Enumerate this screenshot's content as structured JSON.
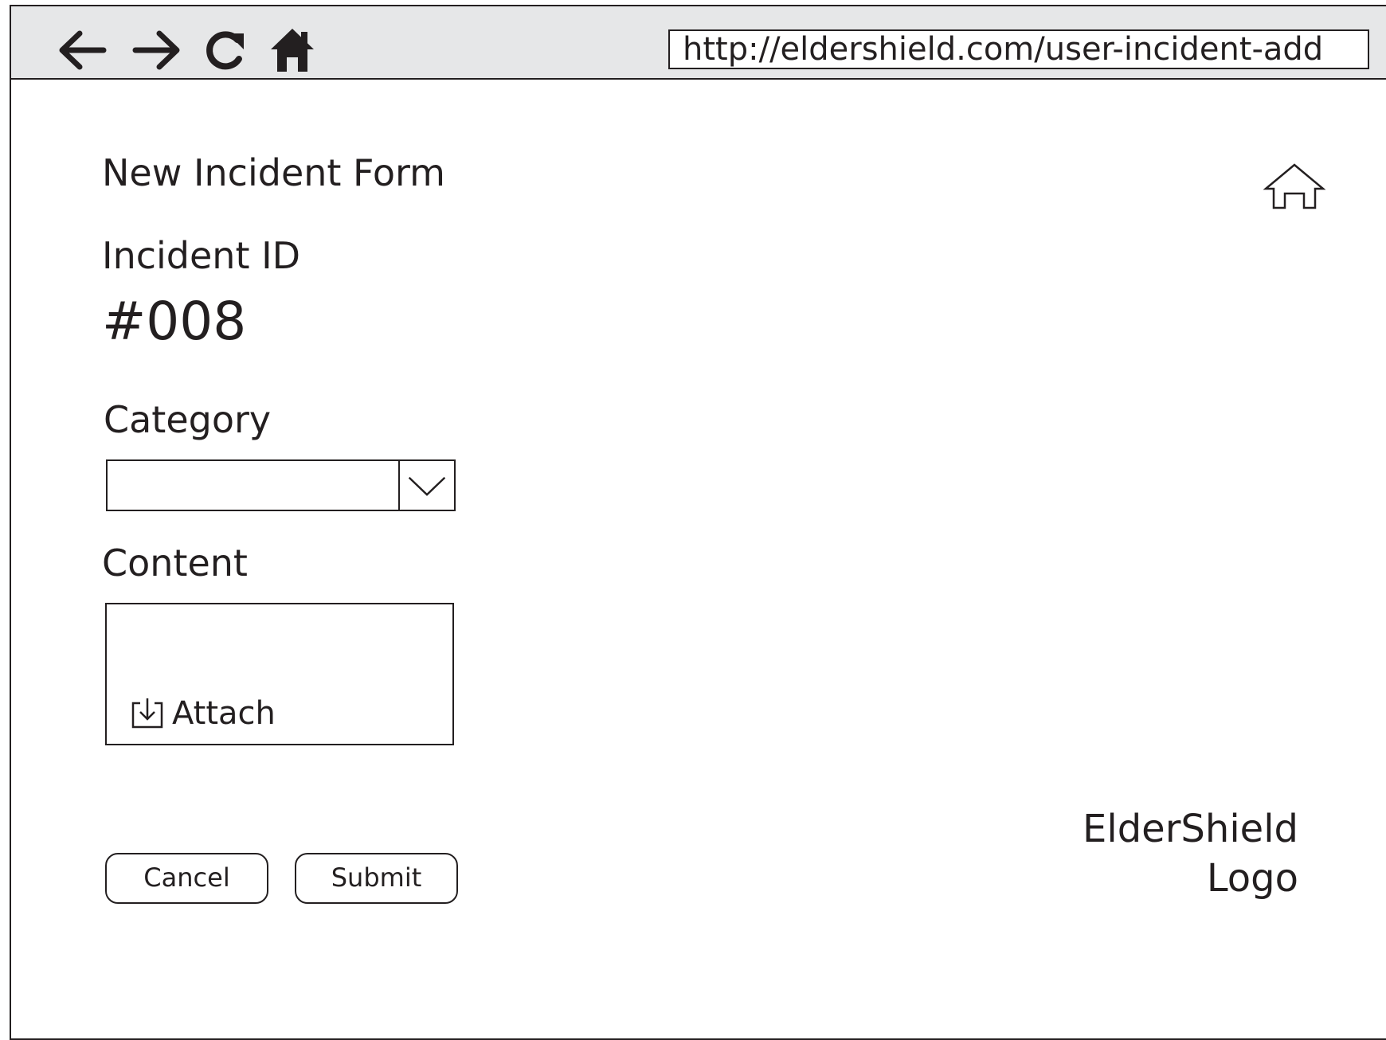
{
  "browser": {
    "url": "http://eldershield.com/user-incident-add",
    "nav_icons": [
      "back-arrow-icon",
      "forward-arrow-icon",
      "reload-icon",
      "home-filled-icon"
    ]
  },
  "form": {
    "title": "New Incident Form",
    "incident_id_label": "Incident ID",
    "incident_id_value": "#008",
    "category_label": "Category",
    "category_value": "",
    "content_label": "Content",
    "attach_label": "Attach",
    "cancel_label": "Cancel",
    "submit_label": "Submit"
  },
  "page": {
    "home_icon": "home-outline-icon"
  },
  "logo": {
    "line1": "ElderShield",
    "line2": "Logo"
  },
  "colors": {
    "ink": "#231f20",
    "browser_bar": "#e6e7e8",
    "background": "#ffffff"
  }
}
